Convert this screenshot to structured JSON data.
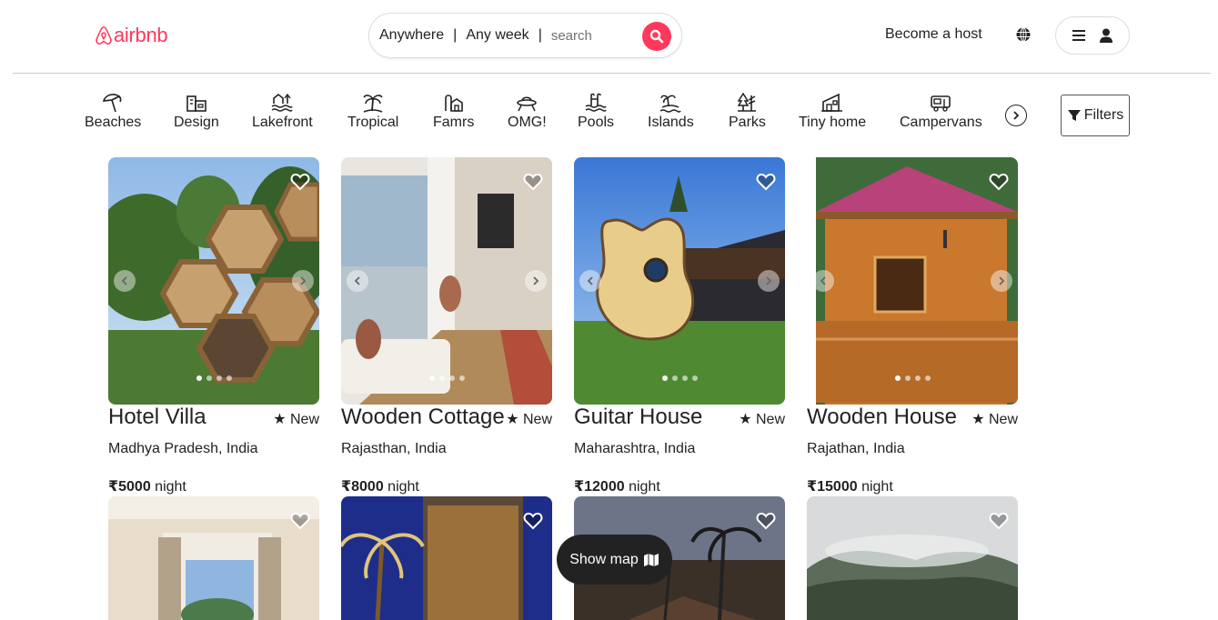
{
  "app": {
    "logo_text": "airbnb",
    "brand_color": "#ff385c"
  },
  "search": {
    "anywhere": "Anywhere",
    "any_week": "Any week",
    "separator": "|",
    "placeholder": "search",
    "search_icon": "search-icon"
  },
  "header": {
    "become_host": "Become a host",
    "globe_icon": "globe-icon",
    "menu_icon": "hamburger-menu-icon",
    "user_icon": "user-icon"
  },
  "categories": [
    {
      "label": "Beaches",
      "icon": "umbrella-icon"
    },
    {
      "label": "Design",
      "icon": "building-icon"
    },
    {
      "label": "Lakefront",
      "icon": "lakefront-icon"
    },
    {
      "label": "Tropical",
      "icon": "palm-tree-icon"
    },
    {
      "label": "Famrs",
      "icon": "farm-icon"
    },
    {
      "label": "OMG!",
      "icon": "ufo-icon"
    },
    {
      "label": "Pools",
      "icon": "pool-icon"
    },
    {
      "label": "Islands",
      "icon": "island-icon"
    },
    {
      "label": "Parks",
      "icon": "tree-icon"
    },
    {
      "label": "Tiny home",
      "icon": "tiny-home-icon"
    },
    {
      "label": "Campervans",
      "icon": "campervan-icon"
    }
  ],
  "filters_label": "Filters",
  "listings": [
    {
      "title": "Hotel Villa",
      "rating": "★ New",
      "location": "Madhya Pradesh, India",
      "price": "₹5000",
      "unit": " night"
    },
    {
      "title": "Wooden Cottage",
      "rating": "★ New",
      "location": "Rajasthan, India",
      "price": "₹8000",
      "unit": " night"
    },
    {
      "title": "Guitar House",
      "rating": "★ New",
      "location": "Maharashtra, India",
      "price": "₹12000",
      "unit": " night"
    },
    {
      "title": "Wooden House",
      "rating": "★ New",
      "location": "Rajathan, India",
      "price": "₹15000",
      "unit": " night"
    }
  ],
  "show_map": "Show map"
}
